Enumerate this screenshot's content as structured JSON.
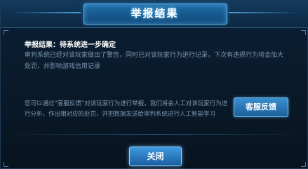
{
  "dialog": {
    "title": "举报结果",
    "result_title": "举报结果：待系统进一步确定",
    "description": "审判系统已经对该玩家做出了警告，同时已对该玩家行为进行记录，下次有违规行为将会加大处罚，并影响游戏信用记录",
    "feedback_text": "您可以通过“客服反馈”对该玩家行为进行举报，我们将会人工对该玩家行为进行分析，作出相对应的处罚，并把数据发送给审判系统进行人工智能学习",
    "cs_button_label": "客服反馈",
    "close_button_label": "关闭"
  }
}
